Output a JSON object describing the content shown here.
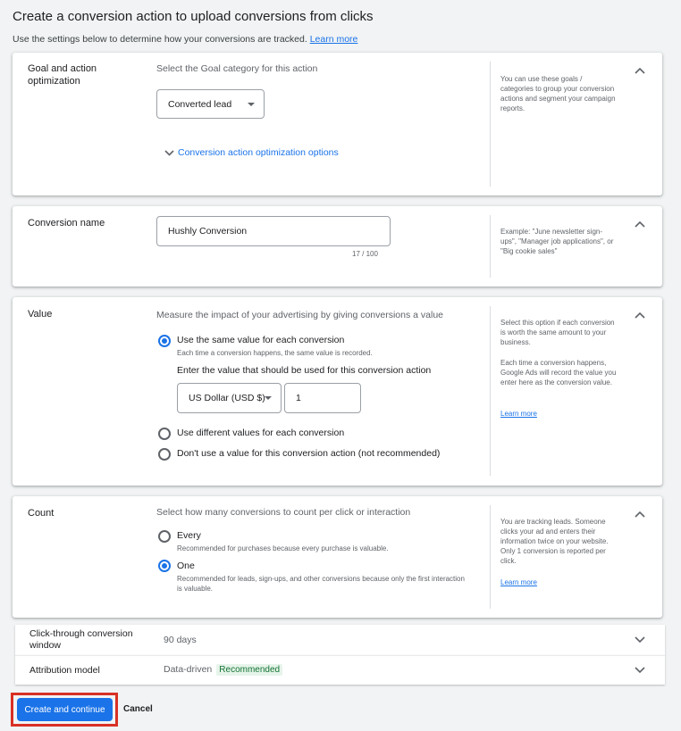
{
  "header": {
    "title": "Create a conversion action to upload conversions from clicks",
    "subtitle": "Use the settings below to determine how your conversions are tracked.",
    "learn_more": "Learn more"
  },
  "goal": {
    "label": "Goal and action optimization",
    "hint": "Select the Goal category for this action",
    "select_value": "Converted lead",
    "expand_link": "Conversion action optimization options",
    "help": "You can use these goals / categories to group your conversion actions and segment your campaign reports."
  },
  "conversion_name": {
    "label": "Conversion name",
    "value": "Hushly Conversion",
    "counter": "17 / 100",
    "help": "Example: \"June newsletter sign-ups\", \"Manager job applications\", or \"Big cookie sales\""
  },
  "value": {
    "label": "Value",
    "hint": "Measure the impact of your advertising by giving conversions a value",
    "option_same": "Use the same value for each conversion",
    "option_same_desc": "Each time a conversion happens, the same value is recorded.",
    "enter_value_label": "Enter the value that should be used for this conversion action",
    "currency": "US Dollar (USD $)",
    "amount": "1",
    "option_different": "Use different values for each conversion",
    "option_none": "Don't use a value for this conversion action (not recommended)",
    "help_1": "Select this option if each conversion is worth the same amount to your business.",
    "help_2": "Each time a conversion happens, Google Ads will record the value you enter here as the conversion value.",
    "help_link": "Learn more"
  },
  "count": {
    "label": "Count",
    "hint": "Select how many conversions to count per click or interaction",
    "option_every": "Every",
    "option_every_desc": "Recommended for purchases because every purchase is valuable.",
    "option_one": "One",
    "option_one_desc": "Recommended for leads, sign-ups, and other conversions because only the first interaction is valuable.",
    "help": "You are tracking leads. Someone clicks your ad and enters their information twice on your website. Only 1 conversion is reported per click.",
    "help_link": "Learn more"
  },
  "click_through": {
    "label": "Click-through conversion window",
    "value": "90 days"
  },
  "attribution": {
    "label": "Attribution model",
    "value": "Data-driven",
    "badge": "Recommended"
  },
  "footer": {
    "create_label": "Create and continue",
    "cancel_label": "Cancel"
  },
  "colors": {
    "accent": "#1a73e8",
    "highlight": "#d93025",
    "badge_bg": "#e6f4ea",
    "badge_text": "#137333"
  }
}
